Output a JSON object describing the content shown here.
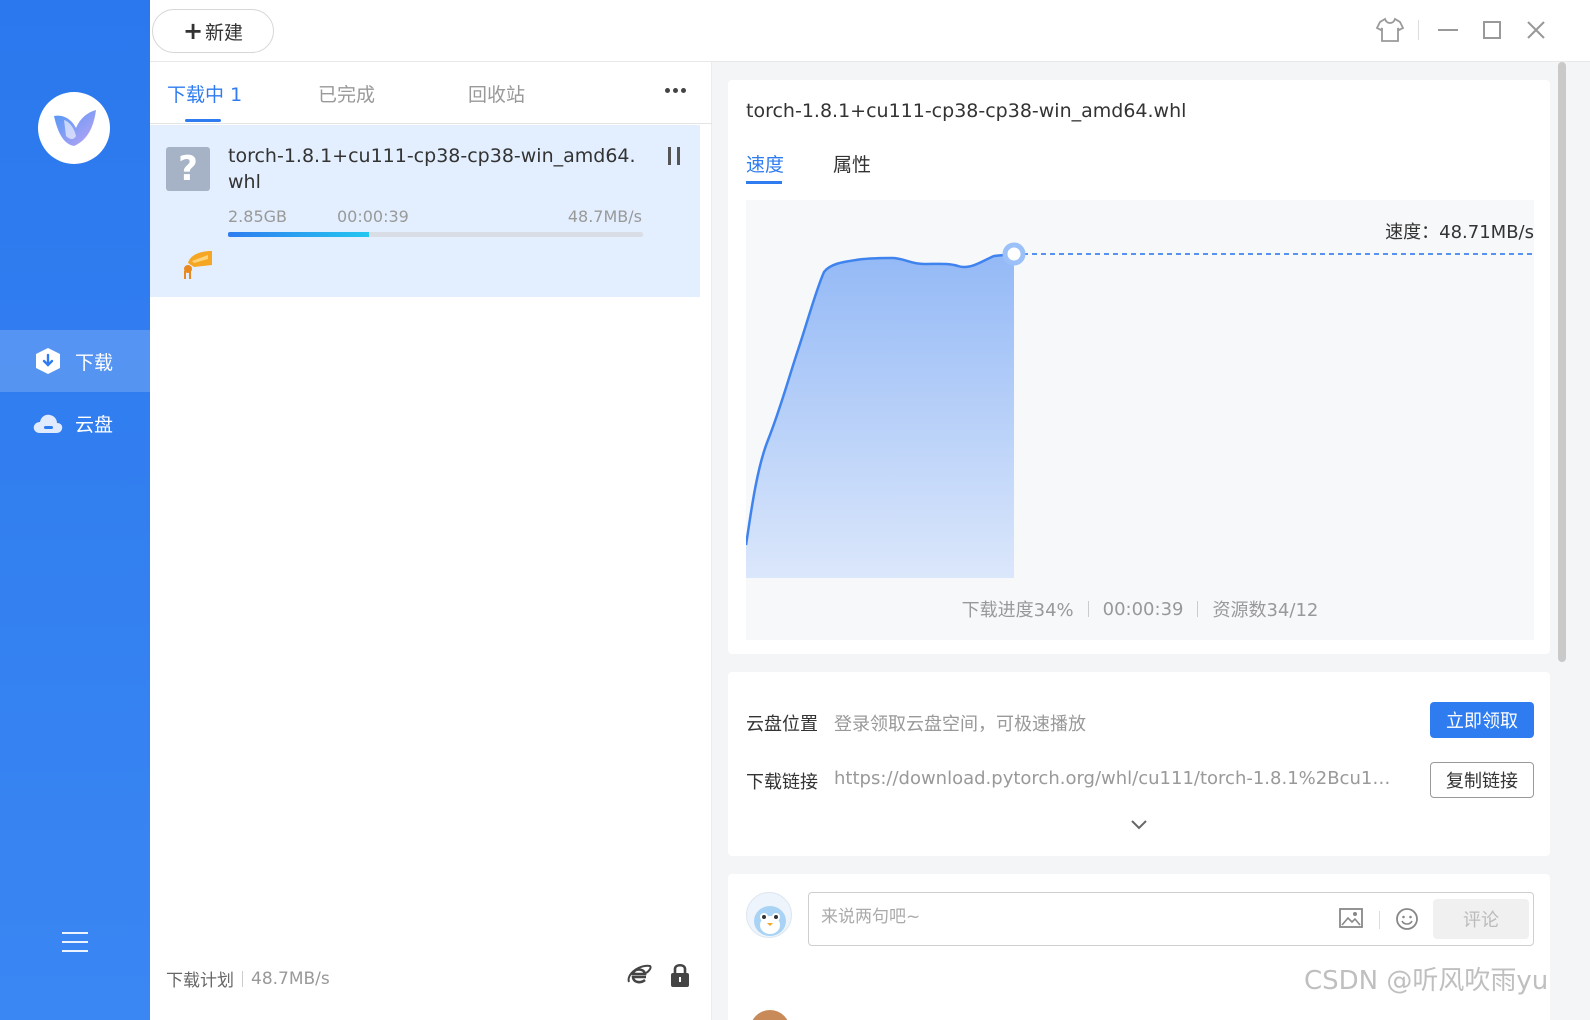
{
  "sidebar": {
    "items": [
      {
        "label": "下载",
        "icon": "download-shield-icon",
        "active": true
      },
      {
        "label": "云盘",
        "icon": "cloud-icon",
        "active": false
      }
    ],
    "menu_icon": "hamburger-menu-icon"
  },
  "topbar": {
    "new_label": "新建",
    "window_controls": [
      "skin-icon",
      "minimize-icon",
      "maximize-icon",
      "close-icon"
    ]
  },
  "left": {
    "tabs": [
      {
        "label": "下载中",
        "count": "1",
        "active": true
      },
      {
        "label": "已完成",
        "active": false
      },
      {
        "label": "回收站",
        "active": false
      }
    ],
    "task": {
      "filename": "torch-1.8.1+cu111-cp38-cp38-win_amd64.whl",
      "size": "2.85GB",
      "elapsed": "00:00:39",
      "speed": "48.7MB/s",
      "progress": 0.34
    },
    "footer": {
      "plan_label": "下载计划",
      "speed": "48.7MB/s"
    }
  },
  "detail": {
    "title": "torch-1.8.1+cu111-cp38-cp38-win_amd64.whl",
    "tabs": [
      {
        "label": "速度",
        "active": true
      },
      {
        "label": "属性",
        "active": false
      }
    ],
    "speed_label": "速度：48.71MB/s",
    "stats": {
      "progress": "下载进度34%",
      "time": "00:00:39",
      "sources": "资源数34/12"
    }
  },
  "cloud": {
    "location_label": "云盘位置",
    "location_value": "登录领取云盘空间，可极速播放",
    "claim_button": "立即领取",
    "link_label": "下载链接",
    "link_value": "https://download.pytorch.org/whl/cu111/torch-1.8.1%2Bcu11...",
    "copy_button": "复制链接"
  },
  "comment": {
    "placeholder": "来说两句吧~",
    "submit_label": "评论"
  },
  "colors": {
    "accent": "#2f7cf0",
    "sidebar": "#2b78ee",
    "task_bg": "#e3efff"
  },
  "watermark": "CSDN @听风吹雨yu"
}
